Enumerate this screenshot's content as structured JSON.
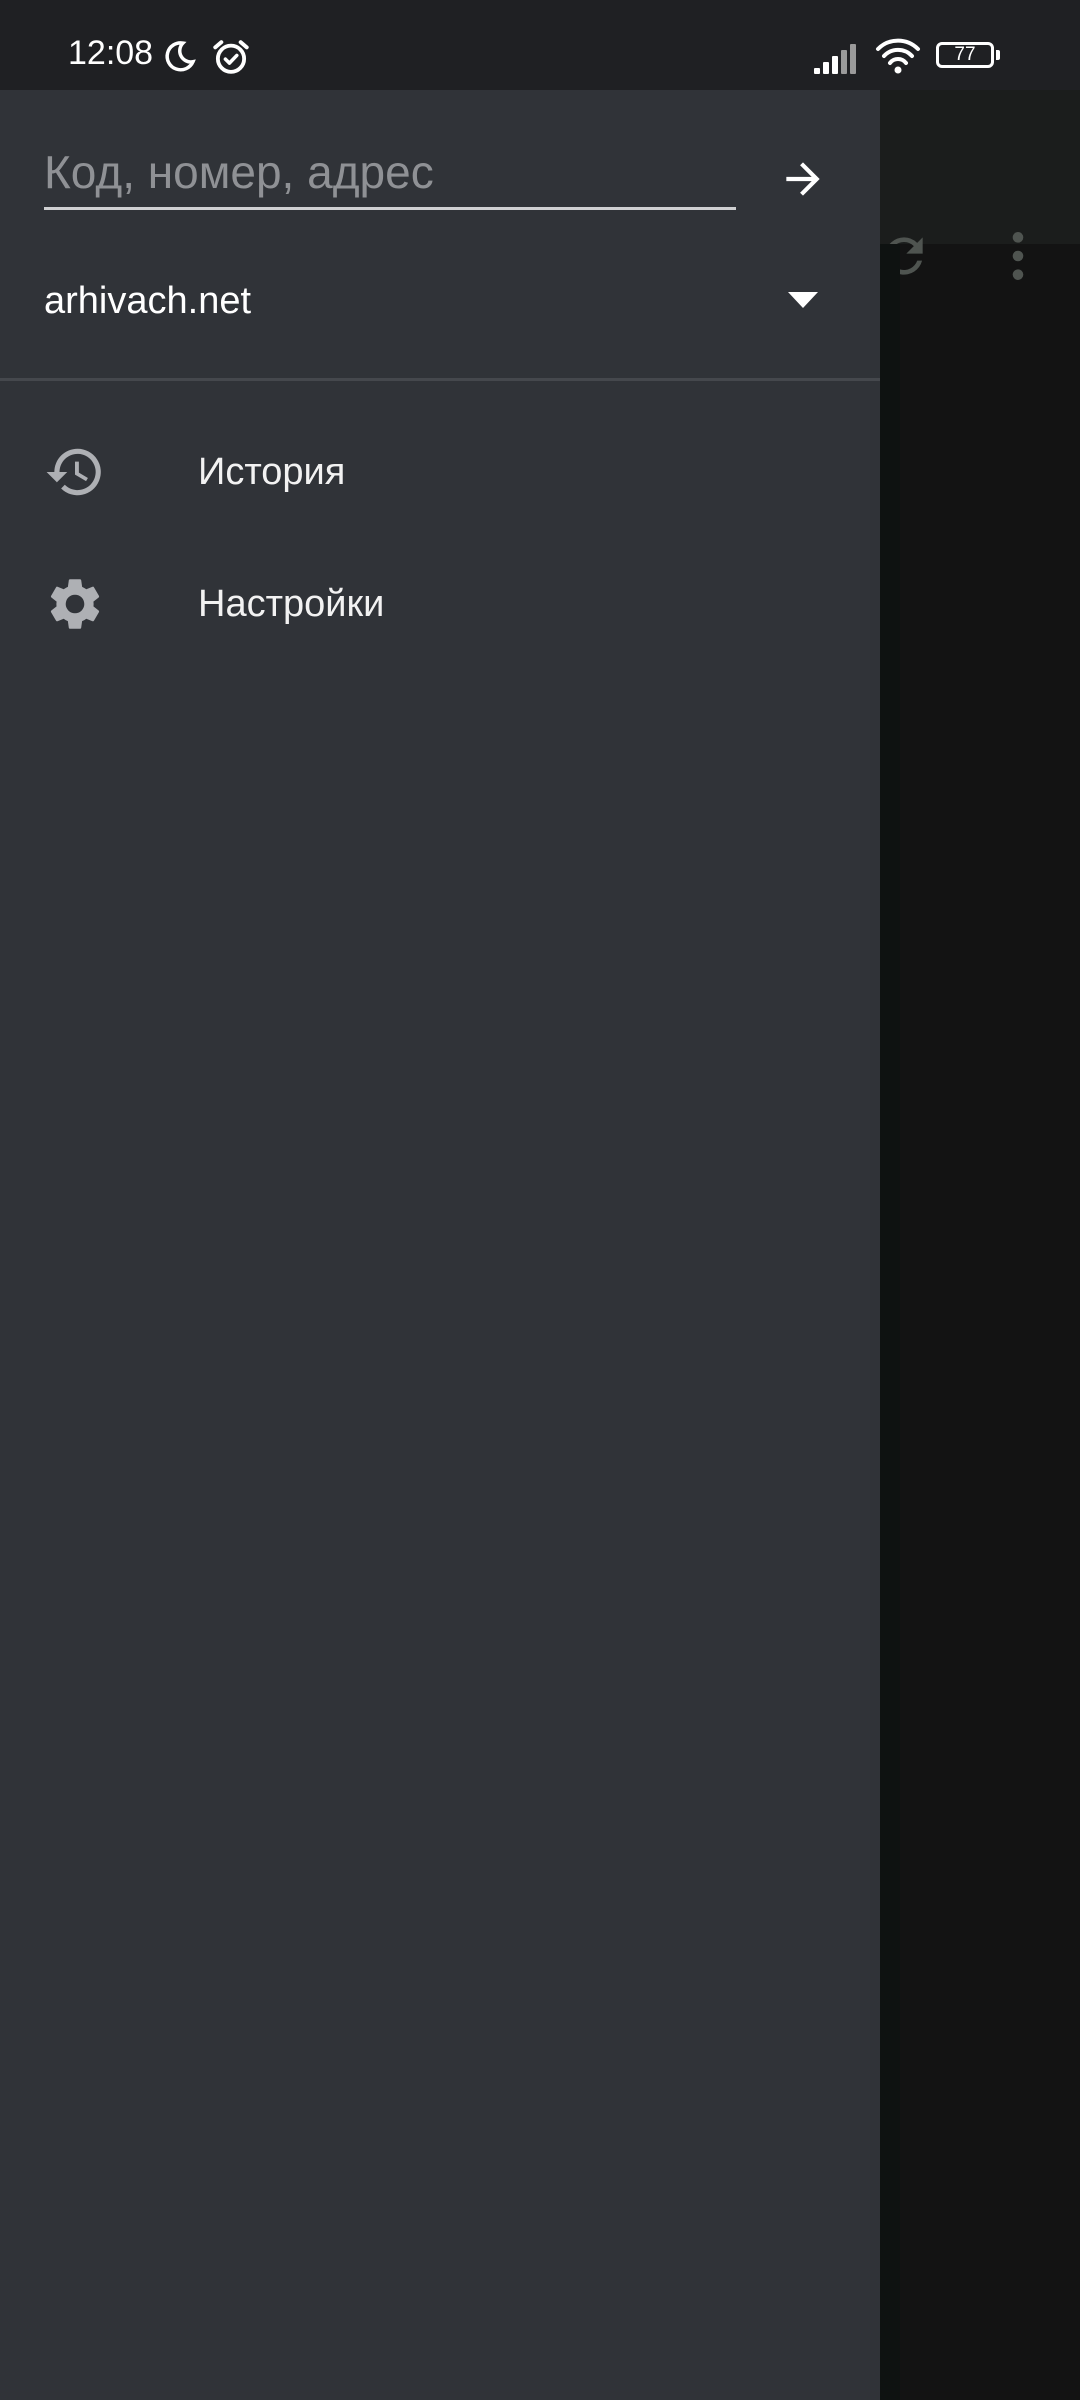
{
  "status_bar": {
    "time": "12:08",
    "battery": "77",
    "icons": [
      "moon-icon",
      "alarm-icon",
      "signal-icon",
      "wifi-icon",
      "battery-icon"
    ]
  },
  "drawer": {
    "search": {
      "placeholder": "Код, номер, адрес",
      "value": ""
    },
    "go_icon": "arrow-right-icon",
    "site_selector": {
      "selected": "arhivach.net",
      "icon": "dropdown-arrow-icon"
    },
    "menu": [
      {
        "label": "История",
        "icon": "history-icon"
      },
      {
        "label": "Настройки",
        "icon": "gear-icon"
      }
    ]
  },
  "background_toolbar": {
    "icons": [
      "refresh-icon",
      "more-vert-icon"
    ]
  },
  "colors": {
    "drawer_bg": "#303338",
    "status_bar_bg": "#1f2023",
    "scrim_bg": "#131313",
    "text_primary": "#ffffff",
    "placeholder": "#8f9195"
  }
}
